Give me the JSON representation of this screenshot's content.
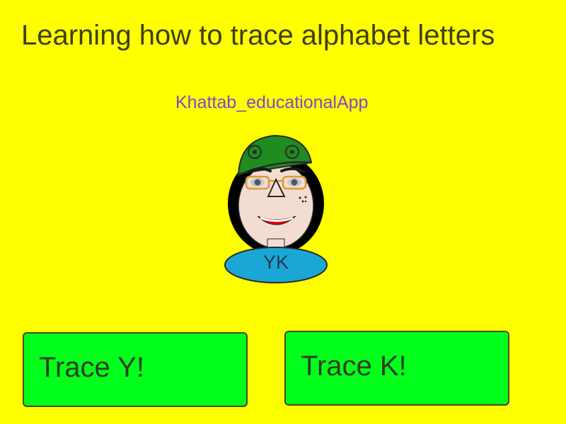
{
  "title": "Learning how to trace alphabet letters",
  "credit": "Khattab_educationalApp",
  "avatar": {
    "initials": "YK"
  },
  "buttons": {
    "trace_y": "Trace Y!",
    "trace_k": "Trace K!"
  },
  "colors": {
    "background": "#ffff00",
    "button": "#00ff1b",
    "credit_text": "#8746c4",
    "hat": "#1f8c1f",
    "nameplate": "#1aa7d6"
  }
}
